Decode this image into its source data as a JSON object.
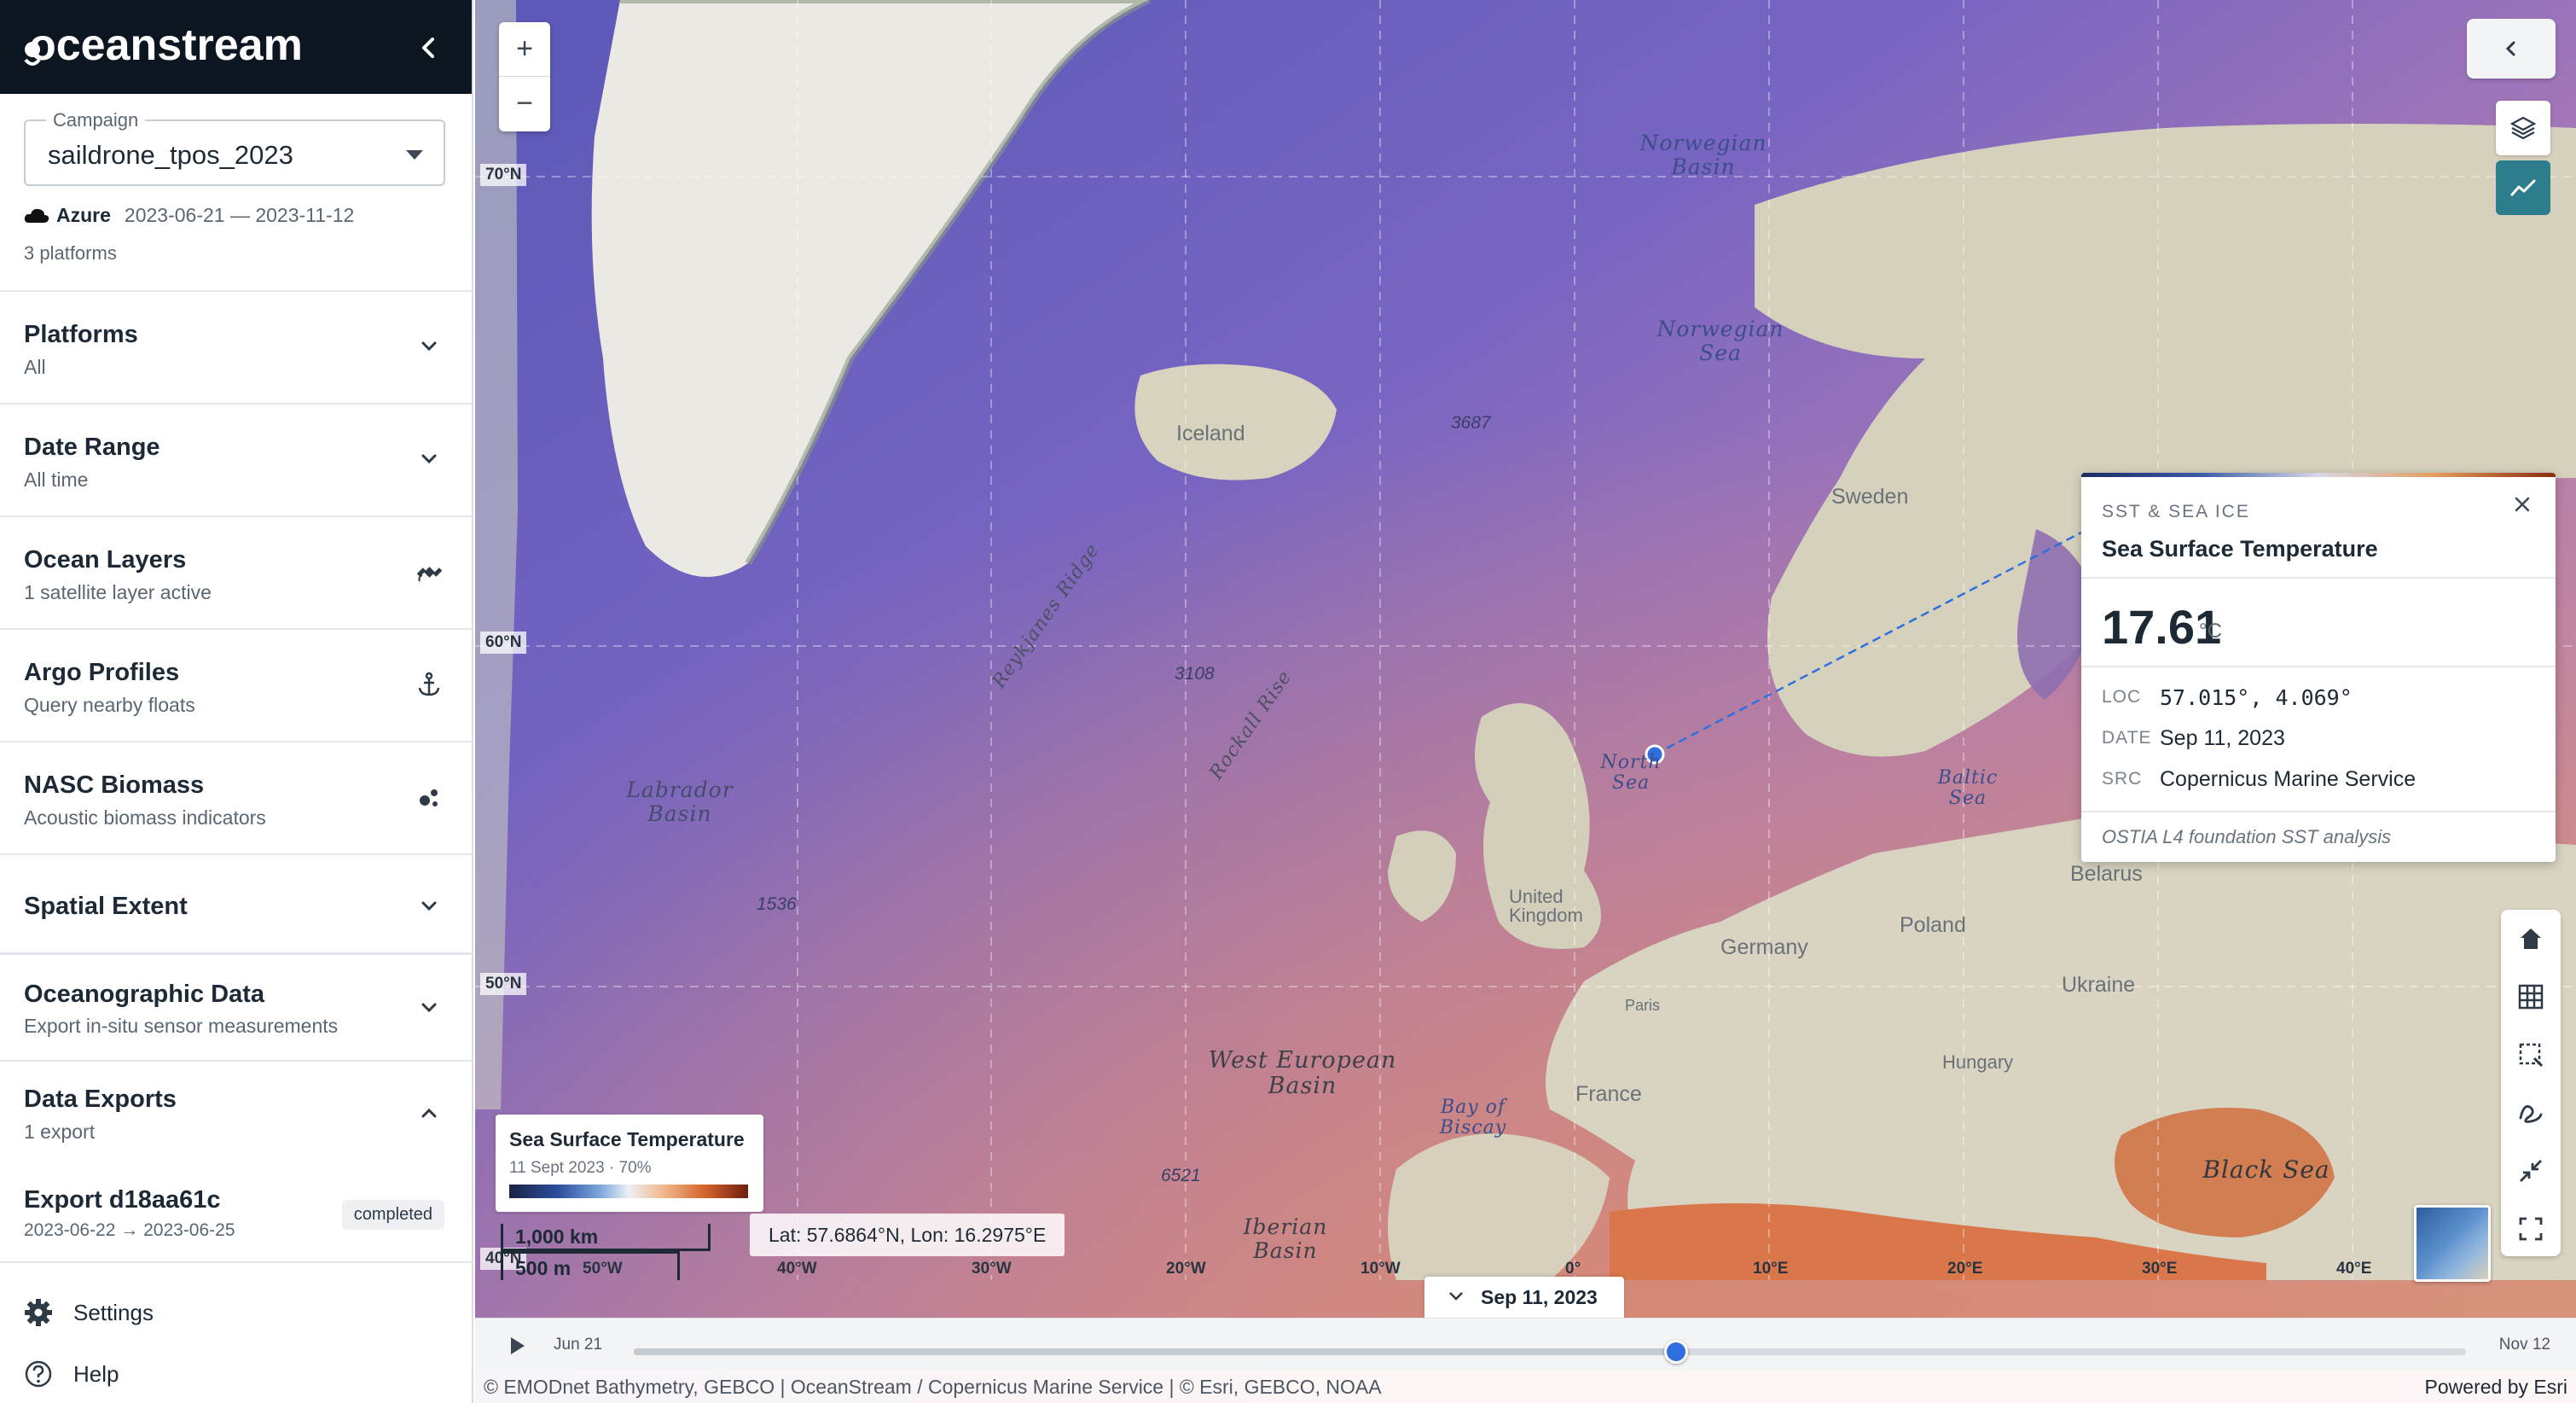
{
  "brand": {
    "name": "oceanstream"
  },
  "campaign": {
    "label": "Campaign",
    "value": "saildrone_tpos_2023",
    "provider": "Azure",
    "date_range": "2023-06-21 — 2023-11-12",
    "platforms_count": "3 platforms"
  },
  "sections": [
    {
      "title": "Platforms",
      "subtitle": "All",
      "icon": "chevron-down-icon"
    },
    {
      "title": "Date Range",
      "subtitle": "All time",
      "icon": "chevron-down-icon"
    },
    {
      "title": "Ocean Layers",
      "subtitle": "1 satellite layer active",
      "icon": "satellite-icon"
    },
    {
      "title": "Argo Profiles",
      "subtitle": "Query nearby floats",
      "icon": "anchor-icon"
    },
    {
      "title": "NASC Biomass",
      "subtitle": "Acoustic biomass indicators",
      "icon": "dots-icon"
    },
    {
      "title": "Spatial Extent",
      "subtitle": "",
      "icon": "chevron-down-icon"
    },
    {
      "title": "Oceanographic Data",
      "subtitle": "Export in-situ sensor measurements",
      "icon": "chevron-down-icon"
    },
    {
      "title": "Data Exports",
      "subtitle": "1 export",
      "icon": "chevron-up-icon"
    }
  ],
  "export": {
    "id": "Export d18aa61c",
    "range": "2023-06-22 → 2023-06-25",
    "status": "completed"
  },
  "footer": {
    "settings": "Settings",
    "help": "Help"
  },
  "map": {
    "zoom_in": "+",
    "zoom_out": "−",
    "sea_labels": [
      {
        "text": "Norwegian\nBasin"
      },
      {
        "text": "Norwegian\nSea"
      },
      {
        "text": "North\nSea"
      },
      {
        "text": "Baltic\nSea"
      },
      {
        "text": "Labrador\nBasin"
      },
      {
        "text": "West European\nBasin"
      },
      {
        "text": "Bay of\nBiscay"
      },
      {
        "text": "Iberian\nBasin"
      },
      {
        "text": "Black Sea"
      },
      {
        "text": "Reykjanes Ridge"
      },
      {
        "text": "Rockall Rise"
      }
    ],
    "land_labels": [
      "Iceland",
      "Sweden",
      "Poland",
      "Germany",
      "Ukraine",
      "Belarus",
      "France",
      "Hungary",
      "United\nKingdom",
      "Paris"
    ],
    "depth_labels": [
      "3687",
      "3108",
      "1536",
      "6521"
    ],
    "lat_labels": [
      "70°N",
      "60°N",
      "50°N",
      "40°N"
    ],
    "lon_labels": [
      "50°W",
      "40°W",
      "30°W",
      "20°W",
      "10°W",
      "0°",
      "10°E",
      "20°E",
      "30°E",
      "40°E"
    ]
  },
  "popup": {
    "kicker": "SST & SEA ICE",
    "title": "Sea Surface Temperature",
    "value": "17.61",
    "unit": "°C",
    "loc_key": "LOC",
    "loc_val": "57.015°, 4.069°",
    "date_key": "DATE",
    "date_val": "Sep 11, 2023",
    "src_key": "SRC",
    "src_val": "Copernicus Marine Service",
    "note": "OSTIA L4 foundation SST analysis"
  },
  "legend": {
    "title": "Sea Surface Temperature",
    "subtitle": "11 Sept 2023 · 70%"
  },
  "scale": {
    "km": "1,000 km",
    "mi": "500 m"
  },
  "coords": "Lat: 57.6864°N, Lon: 16.2975°E",
  "timeline": {
    "current_date": "Sep 11, 2023",
    "start": "Jun 21",
    "end": "Nov 12",
    "progress": 0.569
  },
  "attribution": {
    "left": "© EMODnet Bathymetry, GEBCO | OceanStream / Copernicus Marine Service | © Esri, GEBCO, NOAA",
    "right": "Powered by Esri"
  },
  "colors": {
    "sidebar_header": "#0c1621",
    "accent": "#2f6fe0",
    "active_tool": "#2e7d8c"
  }
}
